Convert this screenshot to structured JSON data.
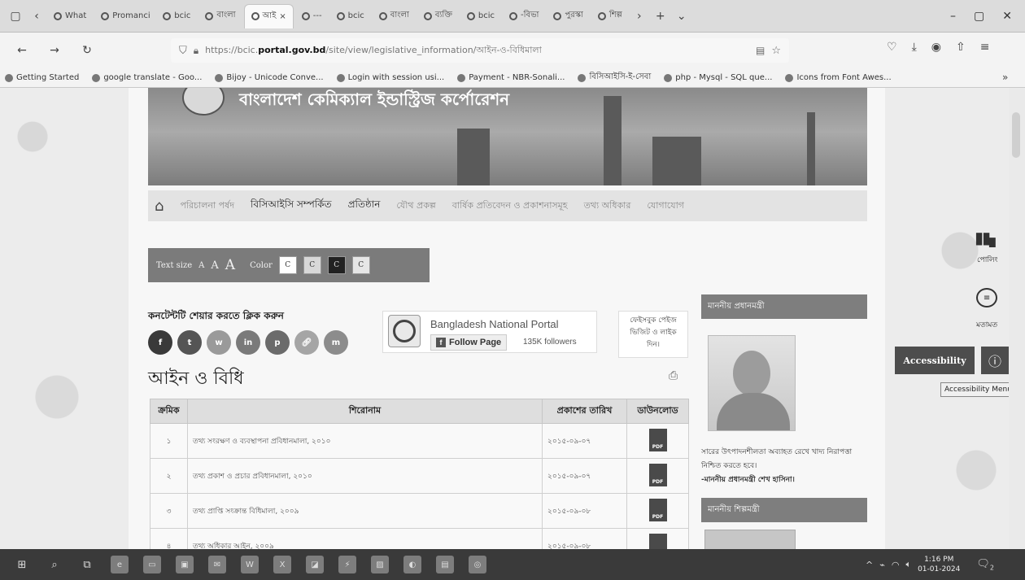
{
  "browser": {
    "tabs": [
      {
        "label": "What",
        "active": false
      },
      {
        "label": "Promanci",
        "active": false
      },
      {
        "label": "bcic",
        "active": false
      },
      {
        "label": "বাংলা",
        "active": false
      },
      {
        "label": "আই",
        "active": true
      },
      {
        "label": "---",
        "active": false
      },
      {
        "label": "bcic",
        "active": false
      },
      {
        "label": "বাংলা",
        "active": false
      },
      {
        "label": "ব্যক্তি",
        "active": false
      },
      {
        "label": "bcic",
        "active": false
      },
      {
        "label": "-বিভা",
        "active": false
      },
      {
        "label": "পুরস্কা",
        "active": false
      },
      {
        "label": "শিল্প",
        "active": false
      }
    ],
    "url_prefix": "https://bcic.",
    "url_domain": "portal.gov.bd",
    "url_path": "/site/view/legislative_information/আইন-ও-বিধিমালা",
    "bookmarks": [
      "Getting Started",
      "google translate - Goo...",
      "Bijoy - Unicode Conve...",
      "Login with session usi...",
      "Payment - NBR-Sonali...",
      "বিসিআইসি-ই-সেবা",
      "php - Mysql - SQL que...",
      "Icons from Font Awes..."
    ]
  },
  "site": {
    "banner_title": "বাংলাদেশ কেমিক্যাল ইন্ডাস্ট্রিজ কর্পোরেশন",
    "nav": [
      {
        "label": "পরিচালনা পর্ষদ",
        "strong": false
      },
      {
        "label": "বিসিআইসি সম্পর্কিত",
        "strong": true
      },
      {
        "label": "প্রতিষ্ঠান",
        "strong": true
      },
      {
        "label": "যৌথ প্রকল্প",
        "strong": false
      },
      {
        "label": "বার্ষিক প্রতিবেদন ও প্রকাশনাসমূহ",
        "strong": false
      },
      {
        "label": "তথ্য অধিকার",
        "strong": false
      },
      {
        "label": "যোগাযোগ",
        "strong": false
      }
    ],
    "text_size_label": "Text size",
    "text_size_options": [
      "A",
      "A",
      "A"
    ],
    "color_label": "Color",
    "color_options": [
      "C",
      "C",
      "C",
      "C"
    ],
    "share_title": "কনটেন্টটি শেয়ার করতে ক্লিক করুন",
    "share_icons": [
      "facebook-icon",
      "twitter-icon",
      "whatsapp-icon",
      "linkedin-icon",
      "pinterest-icon",
      "link-icon",
      "messenger-icon"
    ],
    "fb_widget": {
      "name": "Bangladesh National Portal",
      "follow_label": "Follow Page",
      "followers": "135K followers"
    },
    "fb_note": "ফেইসবুক পেইজ ভিজিট ও লাইক দিন।",
    "page_title": "আইন ও বিধি",
    "table": {
      "headers": [
        "ক্রমিক",
        "শিরোনাম",
        "প্রকাশের তারিখ",
        "ডাউনলোড"
      ],
      "rows": [
        {
          "no": "১",
          "title": "তথ্য সংরক্ষণ ও ব্যবস্থাপনা প্রবিধানমালা, ২০১০",
          "date": "২০১৫-০৯-০৭",
          "download": "PDF"
        },
        {
          "no": "২",
          "title": "তথ্য প্রকাশ ও প্রচার প্রবিধানমালা, ২০১০",
          "date": "২০১৫-০৯-০৭",
          "download": "PDF"
        },
        {
          "no": "৩",
          "title": "তথ্য প্রাপ্তি সংক্রান্ত বিধিমালা, ২০০৯",
          "date": "২০১৫-০৯-০৮",
          "download": "PDF"
        },
        {
          "no": "৪",
          "title": "তথ্য অধিকার আইন, ২০০৯",
          "date": "২০১৫-০৯-০৮",
          "download": "PDF"
        }
      ]
    },
    "sidebar": {
      "pm_heading": "মাননীয় প্রধানমন্ত্রী",
      "pm_quote": "সারের উৎপাদনশীলতা অব্যাহত রেখে খাদ্য নিরাপত্তা নিশ্চিত করতে হবে।",
      "pm_signature": "-মাননীয় প্রধানমন্ত্রী শেখ হাসিনা।",
      "minister_heading": "মাননীয় শিল্পমন্ত্রী"
    },
    "floating": {
      "poll_label": "পোলিং",
      "feedback_label": "মতামত",
      "accessibility_label": "Accessibility",
      "accessibility_tooltip": "Accessibility Menu"
    }
  },
  "taskbar": {
    "time": "1:16 PM",
    "date": "01-01-2024",
    "notification_count": "2"
  }
}
